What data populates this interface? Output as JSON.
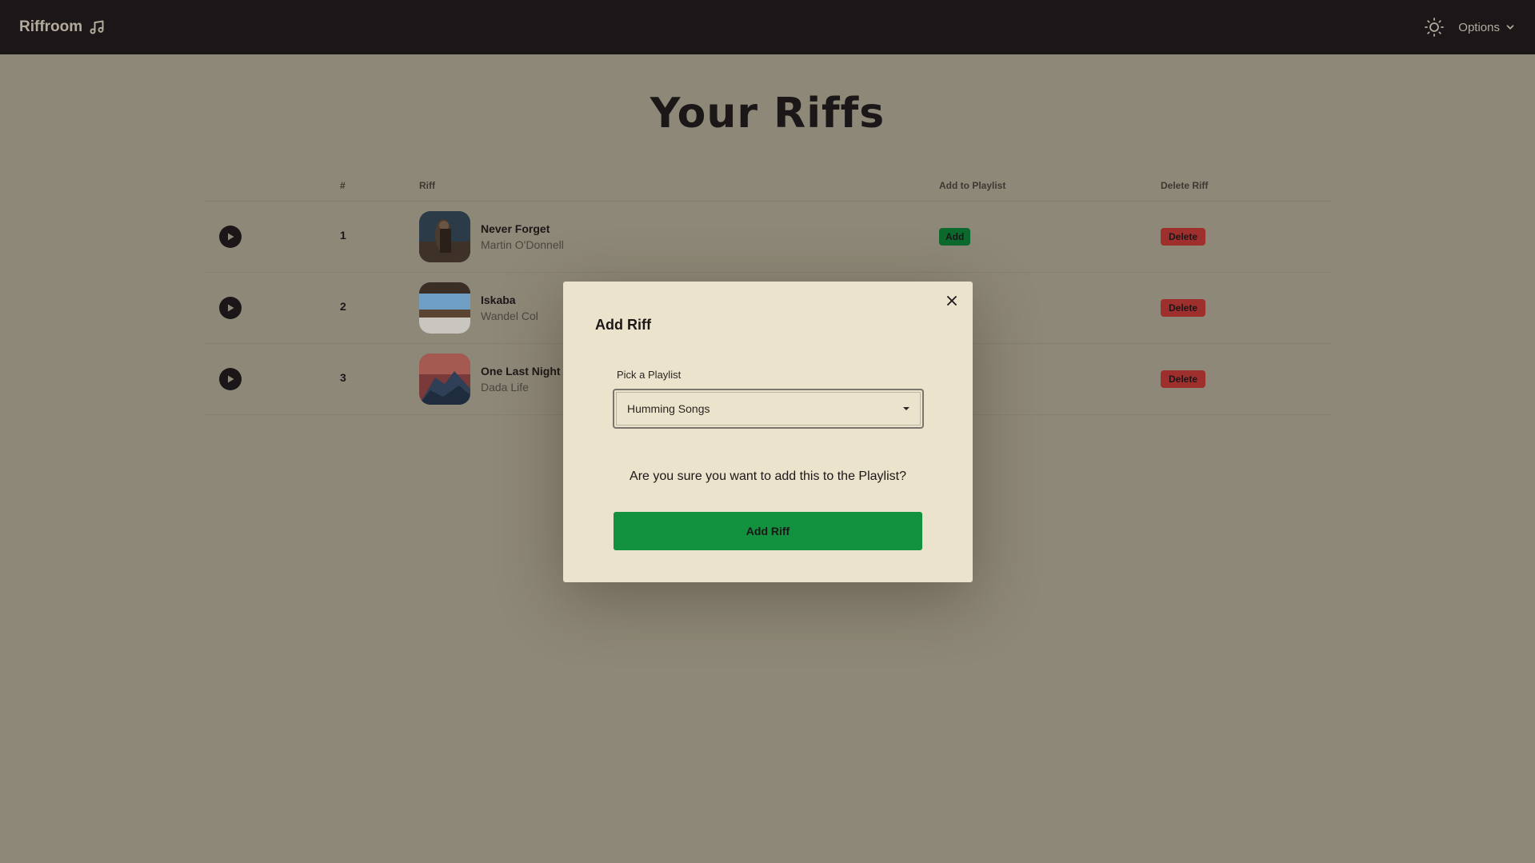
{
  "navbar": {
    "brand": "Riffroom",
    "options_label": "Options"
  },
  "page": {
    "title": "Your Riffs"
  },
  "table": {
    "headers": {
      "num": "#",
      "riff": "Riff",
      "add": "Add to Playlist",
      "delete": "Delete Riff"
    },
    "rows": [
      {
        "num": "1",
        "title": "Never Forget",
        "artist": "Martin O'Donnell",
        "add_label": "Add",
        "delete_label": "Delete"
      },
      {
        "num": "2",
        "title": "Iskaba",
        "artist": "Wandel Col",
        "delete_label": "Delete"
      },
      {
        "num": "3",
        "title": "One Last Night",
        "artist": "Dada Life",
        "delete_label": "Delete"
      }
    ]
  },
  "modal": {
    "title": "Add Riff",
    "select_label": "Pick a Playlist",
    "selected_playlist": "Humming Songs",
    "confirm_text": "Are you sure you want to add this to the Playlist?",
    "submit_label": "Add Riff"
  },
  "colors": {
    "navbar_bg": "#1b1718",
    "page_bg": "#8e8878",
    "add_green": "#0d6a2e",
    "delete_red": "#9f2f2d",
    "modal_bg": "#ece3cc",
    "submit_green": "#12913e"
  },
  "icons": {
    "brand": "music-note-icon",
    "theme": "sun-icon",
    "options": "chevron-down-icon",
    "play": "play-icon",
    "close": "close-icon",
    "select": "caret-down-icon"
  }
}
